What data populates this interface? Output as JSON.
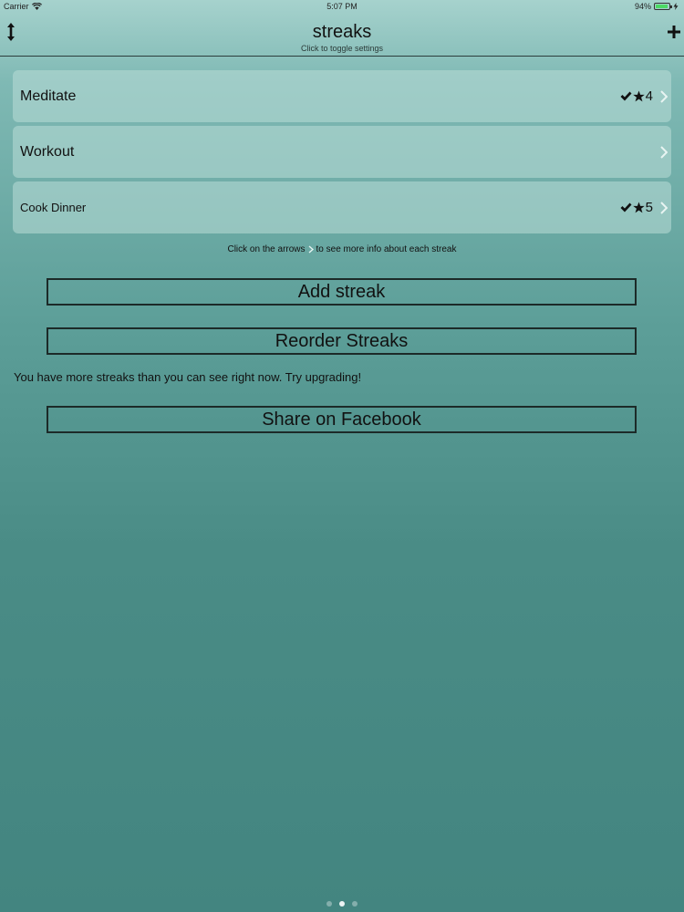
{
  "status_bar": {
    "carrier": "Carrier",
    "time": "5:07 PM",
    "battery": "94%",
    "battery_level": 0.94
  },
  "nav": {
    "title": "streaks",
    "subtitle": "Click to toggle settings",
    "left_icon": "reorder-arrows-icon",
    "right_icon": "plus-icon"
  },
  "streaks": [
    {
      "name": "Meditate",
      "count": "4",
      "completed": true
    },
    {
      "name": "Workout",
      "count": "",
      "completed": false
    },
    {
      "name": "Cook Dinner",
      "count": "5",
      "completed": true
    }
  ],
  "hint": {
    "before": "Click on the arrows",
    "after": "to see more info about each streak"
  },
  "buttons": {
    "add": "Add streak",
    "reorder": "Reorder Streaks",
    "share": "Share on Facebook"
  },
  "upgrade_text": "You have more streaks than you can see right now. Try upgrading!",
  "pager": {
    "pages": 3,
    "active": 1
  }
}
